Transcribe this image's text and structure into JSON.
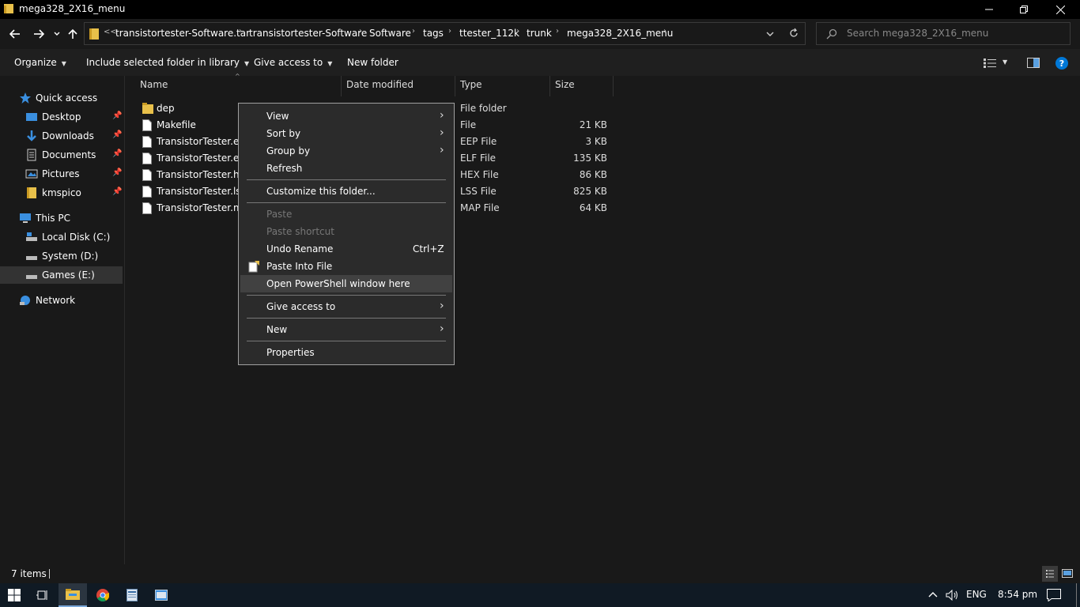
{
  "window": {
    "title": "mega328_2X16_menu"
  },
  "address": {
    "overflow": "<<",
    "crumbs": [
      "transistortester-Software.tar",
      "transistortester-Software",
      "Software",
      "tags",
      "ttester_112k",
      "trunk",
      "mega328_2X16_menu"
    ]
  },
  "search": {
    "placeholder": "Search mega328_2X16_menu"
  },
  "commands": {
    "organize": "Organize",
    "include": "Include selected folder in library",
    "give_access": "Give access to",
    "new_folder": "New folder"
  },
  "nav": {
    "quick_access": "Quick access",
    "desktop": "Desktop",
    "downloads": "Downloads",
    "documents": "Documents",
    "pictures": "Pictures",
    "kmspico": "kmspico",
    "this_pc": "This PC",
    "local_disk": "Local Disk (C:)",
    "system": "System (D:)",
    "games": "Games (E:)",
    "network": "Network"
  },
  "columns": {
    "name": "Name",
    "date": "Date modified",
    "type": "Type",
    "size": "Size"
  },
  "files": [
    {
      "name": "dep",
      "type": "File folder",
      "size": "",
      "kind": "folder"
    },
    {
      "name": "Makefile",
      "type": "File",
      "size": "21 KB",
      "kind": "file"
    },
    {
      "name": "TransistorTester.eep",
      "type": "EEP File",
      "size": "3 KB",
      "kind": "file"
    },
    {
      "name": "TransistorTester.elf",
      "type": "ELF File",
      "size": "135 KB",
      "kind": "file"
    },
    {
      "name": "TransistorTester.hex",
      "type": "HEX File",
      "size": "86 KB",
      "kind": "file"
    },
    {
      "name": "TransistorTester.lss",
      "type": "LSS File",
      "size": "825 KB",
      "kind": "file"
    },
    {
      "name": "TransistorTester.map",
      "type": "MAP File",
      "size": "64 KB",
      "kind": "file"
    }
  ],
  "context_menu": {
    "view": "View",
    "sort_by": "Sort by",
    "group_by": "Group by",
    "refresh": "Refresh",
    "customize": "Customize this folder...",
    "paste": "Paste",
    "paste_shortcut": "Paste shortcut",
    "undo_rename": "Undo Rename",
    "undo_shortcut": "Ctrl+Z",
    "paste_into_file": "Paste Into File",
    "open_powershell": "Open PowerShell window here",
    "give_access": "Give access to",
    "new": "New",
    "properties": "Properties"
  },
  "status": {
    "items": "7 items"
  },
  "tray": {
    "language": "ENG",
    "time": "8:54 pm"
  },
  "colors": {
    "accent": "#0078d7",
    "folder": "#e8c04a"
  }
}
